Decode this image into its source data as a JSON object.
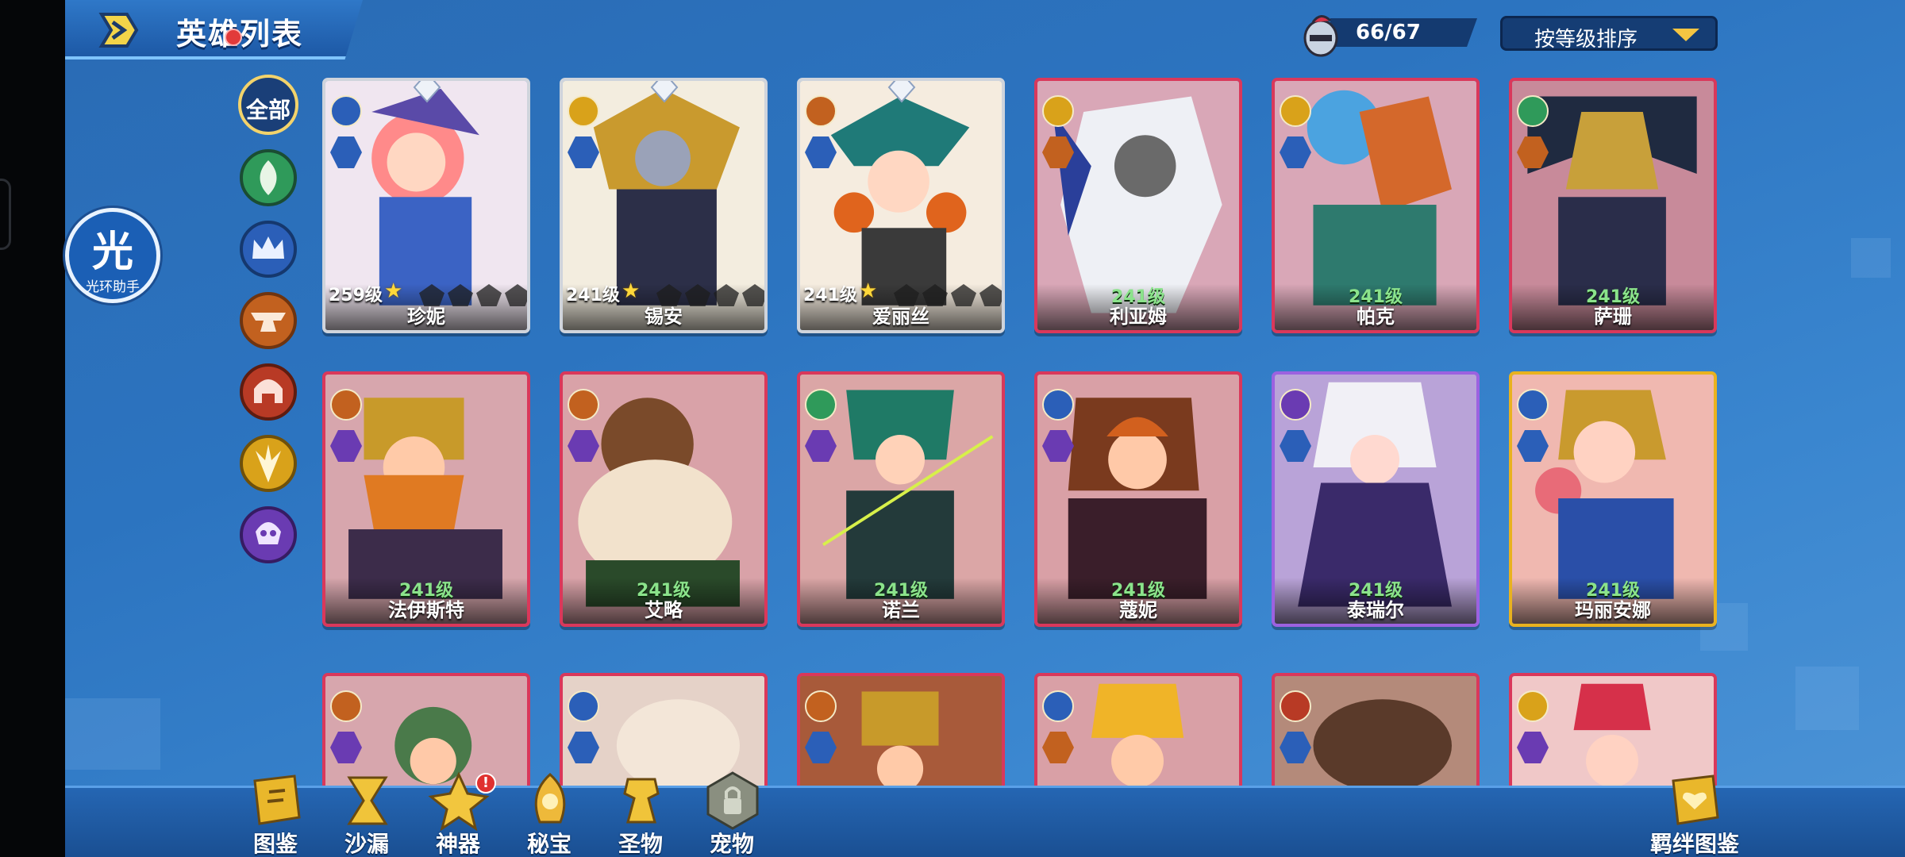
{
  "header": {
    "title": "英雄列表",
    "hero_count": "66/67",
    "sort_select": "按等级排序"
  },
  "aura_helper": {
    "char": "光",
    "label": "光环助手"
  },
  "filters": {
    "all": "全部"
  },
  "colors": {
    "green": "#2f9a5a",
    "blue": "#2b5fb8",
    "orange": "#c2611f",
    "red": "#b83a25",
    "gold": "#d9a21a",
    "purple": "#6a3bb2"
  },
  "heroes": [
    {
      "level": "259级",
      "name": "珍妮",
      "stars": 1,
      "faction": "blue",
      "role": "blue"
    },
    {
      "level": "241级",
      "name": "锡安",
      "stars": 1,
      "faction": "gold",
      "role": "blue"
    },
    {
      "level": "241级",
      "name": "爱丽丝",
      "stars": 1,
      "faction": "orange",
      "role": "blue"
    },
    {
      "level": "241级",
      "name": "利亚姆",
      "stars": 0,
      "faction": "gold",
      "role": "orange"
    },
    {
      "level": "241级",
      "name": "帕克",
      "stars": 0,
      "faction": "gold",
      "role": "blue"
    },
    {
      "level": "241级",
      "name": "萨珊",
      "stars": 0,
      "faction": "green",
      "role": "orange"
    },
    {
      "level": "241级",
      "name": "法伊斯特",
      "stars": 0,
      "faction": "orange",
      "role": "purple"
    },
    {
      "level": "241级",
      "name": "艾略",
      "stars": 0,
      "faction": "orange",
      "role": "purple"
    },
    {
      "level": "241级",
      "name": "诺兰",
      "stars": 0,
      "faction": "green",
      "role": "purple"
    },
    {
      "level": "241级",
      "name": "蔻妮",
      "stars": 0,
      "faction": "blue",
      "role": "purple"
    },
    {
      "level": "241级",
      "name": "泰瑞尔",
      "stars": 0,
      "faction": "purple",
      "role": "blue"
    },
    {
      "level": "241级",
      "name": "玛丽安娜",
      "stars": 0,
      "faction": "blue",
      "role": "blue"
    }
  ],
  "bottom_nav": [
    {
      "label": "图鉴",
      "icon": "book-icon"
    },
    {
      "label": "沙漏",
      "icon": "hourglass-icon"
    },
    {
      "label": "神器",
      "icon": "artifact-icon",
      "alert": "!"
    },
    {
      "label": "秘宝",
      "icon": "treasure-icon"
    },
    {
      "label": "圣物",
      "icon": "relic-icon"
    },
    {
      "label": "宠物",
      "icon": "pet-icon"
    },
    {
      "label": "羁绊图鉴",
      "icon": "bond-book-icon"
    }
  ]
}
